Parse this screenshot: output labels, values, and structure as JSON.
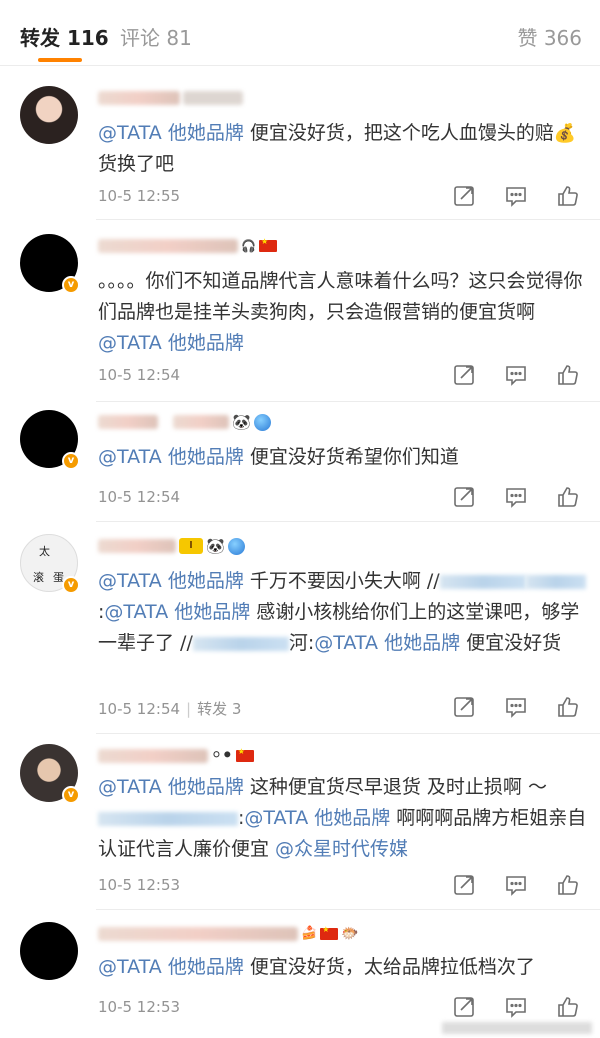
{
  "tabs": {
    "repost_label": "转发",
    "repost_count": "116",
    "comment_label": "评论",
    "comment_count": "81",
    "like_label": "赞",
    "like_count": "366"
  },
  "accent_color": "#ff8200",
  "link_color": "#527db6",
  "comments": [
    {
      "text_parts": [
        "@TATA 他她品牌",
        " 便宜没好货，把这个吃人血馒头的赔",
        "💰",
        "货换了吧"
      ],
      "time": "10-5 12:55"
    },
    {
      "text_parts": [
        "。。。。你们不知道品牌代言人意味着什么吗？这只会觉得你们品牌也是挂羊头卖狗肉，只会造假营销的便宜货啊 ",
        "@TATA 他她品牌"
      ],
      "time": "10-5 12:54"
    },
    {
      "text_parts": [
        "@TATA 他她品牌",
        " 便宜没好货希望你们知道"
      ],
      "time": "10-5 12:54"
    },
    {
      "text_parts": [
        "@TATA 他她品牌",
        " 千万不要因小失大啊 //",
        ":",
        "@TATA 他她品牌",
        " 感谢小核桃给你们上的这堂课吧，够学一辈子了 //",
        "河:",
        "@TATA 他她品牌",
        " 便宜没好货"
      ],
      "time": "10-5 12:54",
      "repost": "转发 3"
    },
    {
      "text_parts": [
        "@TATA 他她品牌",
        " 这种便宜货尽早退货 及时止损啊 ～",
        ":",
        "@TATA 他她品牌",
        " 啊啊啊品牌方柜姐亲自认证代言人廉价便宜 ",
        "@众星时代传媒"
      ],
      "time": "10-5 12:53"
    },
    {
      "text_parts": [
        "@TATA 他她品牌",
        " 便宜没好货，太给品牌拉低档次了"
      ],
      "time": "10-5 12:53"
    }
  ],
  "avatar_labels": [
    "太",
    "滚",
    "蛋"
  ],
  "icons": [
    "share-icon",
    "comment-icon",
    "like-icon"
  ],
  "badge_i": "I"
}
